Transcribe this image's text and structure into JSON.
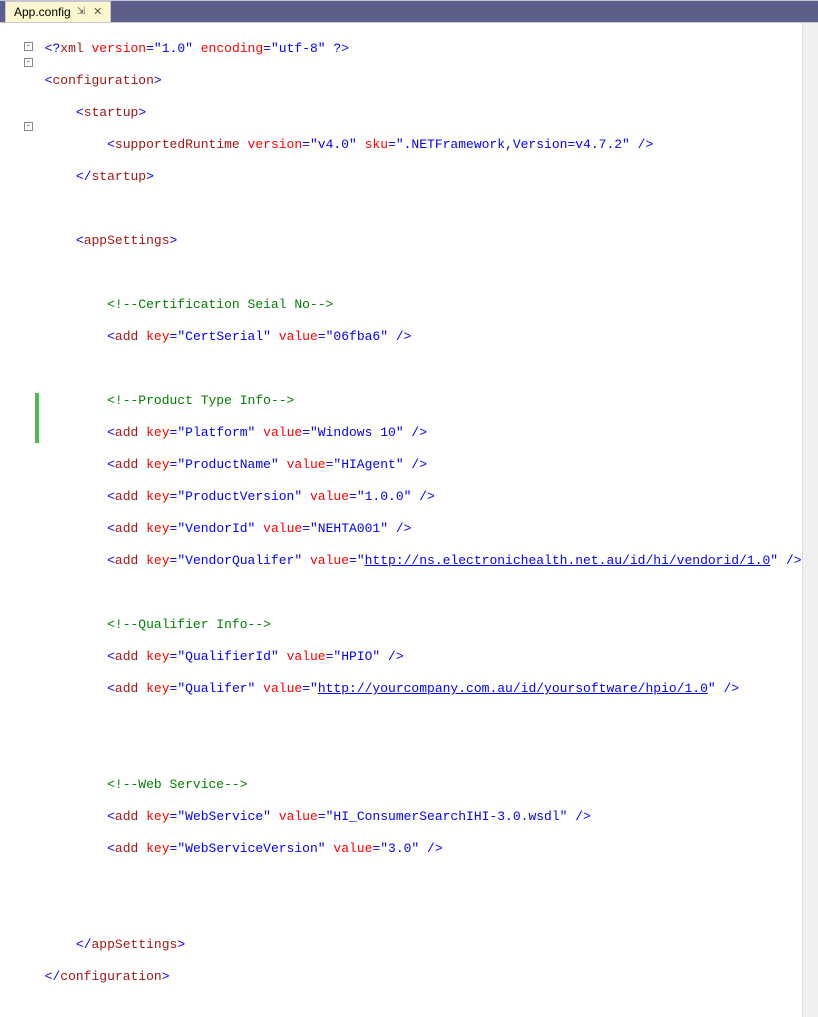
{
  "tab": {
    "title": "App.config",
    "pin": "⇲",
    "close": "✕"
  },
  "code": {
    "l1": {
      "p1": "<?",
      "p2": "xml ",
      "a1": "version",
      "eq": "=",
      "v1": "\"1.0\"",
      "sp": " ",
      "a2": "encoding",
      "v2": "\"utf-8\"",
      "p3": " ?>"
    },
    "l2": {
      "o": "<",
      "tag": "configuration",
      "c": ">"
    },
    "l3": {
      "o": "<",
      "tag": "startup",
      "c": ">"
    },
    "l4": {
      "o": "<",
      "tag": "supportedRuntime",
      "sp": " ",
      "a1": "version",
      "eq": "=",
      "v1": "\"v4.0\"",
      "a2": "sku",
      "v2": "\".NETFramework,Version=v4.7.2\"",
      "end": " />"
    },
    "l5": {
      "o": "</",
      "tag": "startup",
      "c": ">"
    },
    "l7": {
      "o": "<",
      "tag": "appSettings",
      "c": ">"
    },
    "c1": "<!--Certification Seial No-->",
    "add1": {
      "o": "<",
      "tag": "add",
      "sp": " ",
      "a1": "key",
      "eq": "=",
      "v1": "\"CertSerial\"",
      "a2": "value",
      "v2": "\"06fba6\"",
      "end": " />"
    },
    "c2": "<!--Product Type Info-->",
    "add2": {
      "tag": "add",
      "a1": "key",
      "v1": "\"Platform\"",
      "a2": "value",
      "v2": "\"Windows 10\""
    },
    "add3": {
      "tag": "add",
      "a1": "key",
      "v1": "\"ProductName\"",
      "a2": "value",
      "v2": "\"HIAgent\""
    },
    "add4": {
      "tag": "add",
      "a1": "key",
      "v1": "\"ProductVersion\"",
      "a2": "value",
      "v2": "\"1.0.0\""
    },
    "add5": {
      "tag": "add",
      "a1": "key",
      "v1": "\"VendorId\"",
      "a2": "value",
      "v2": "\"NEHTA001\""
    },
    "add6": {
      "tag": "add",
      "a1": "key",
      "v1": "\"VendorQualifer\"",
      "a2": "value",
      "vq": "\"",
      "link": "http://ns.electronichealth.net.au/id/hi/vendorid/1.0",
      "vq2": "\""
    },
    "c3": "<!--Qualifier Info-->",
    "add7": {
      "tag": "add",
      "a1": "key",
      "v1": "\"QualifierId\"",
      "a2": "value",
      "v2": "\"HPIO\""
    },
    "add8": {
      "tag": "add",
      "a1": "key",
      "v1": "\"Qualifer\"",
      "a2": "value",
      "vq": "\"",
      "link": "http://yourcompany.com.au/id/yoursoftware/hpio/1.0",
      "vq2": "\""
    },
    "c4": "<!--Web Service-->",
    "add9": {
      "tag": "add",
      "a1": "key",
      "v1": "\"WebService\"",
      "a2": "value",
      "v2": "\"HI_ConsumerSearchIHI-3.0.wsdl\""
    },
    "add10": {
      "tag": "add",
      "a1": "key",
      "v1": "\"WebServiceVersion\"",
      "a2": "value",
      "v2": "\"3.0\""
    },
    "l_end1": {
      "o": "</",
      "tag": "appSettings",
      "c": ">"
    },
    "l_end2": {
      "o": "</",
      "tag": "configuration",
      "c": ">"
    }
  },
  "sym": {
    "lt": "<",
    "gt": ">",
    "eq": "=",
    "sl": " />",
    "sp": " ",
    "ct": "</"
  }
}
